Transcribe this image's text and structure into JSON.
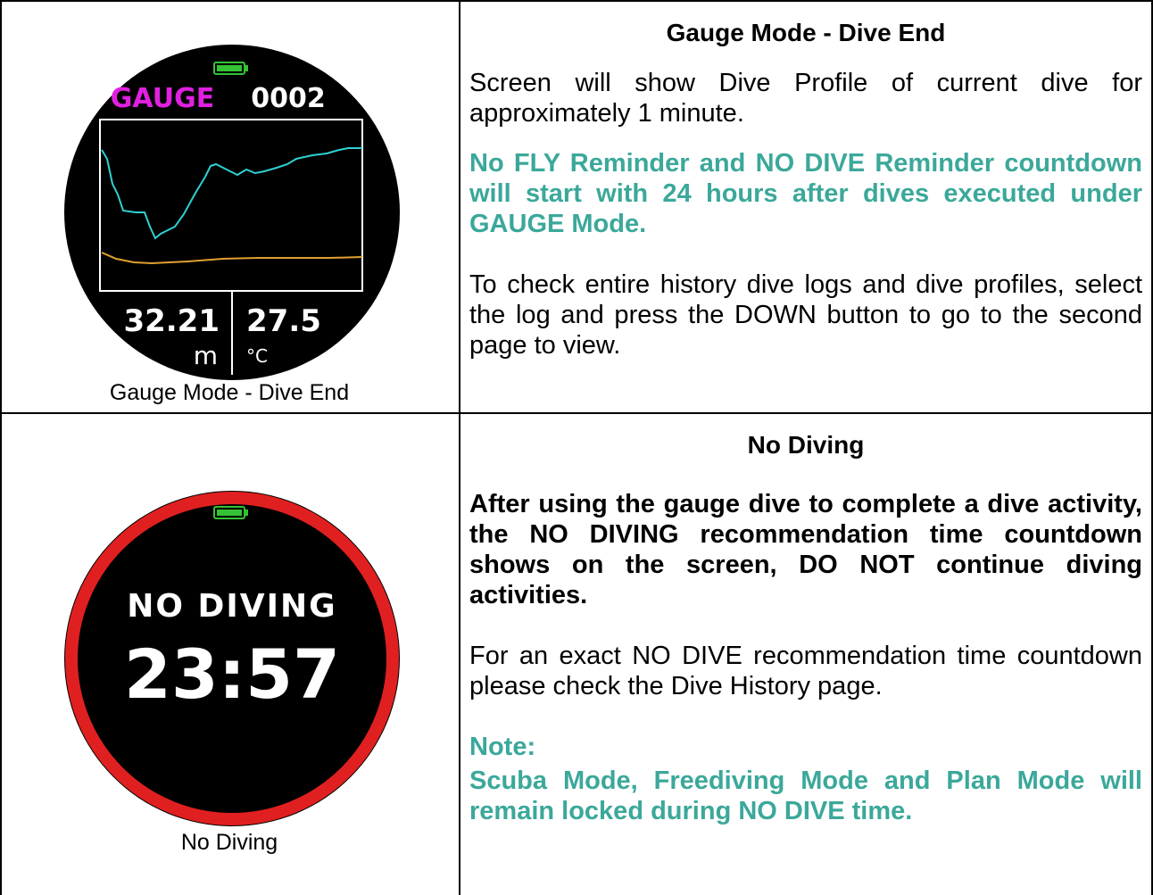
{
  "row1": {
    "watch": {
      "mode_label": "GAUGE",
      "dive_number": "0002",
      "depth_value": "32.21",
      "depth_unit": "m",
      "temp_value": "27.5",
      "temp_unit": "°C",
      "colors": {
        "mode": "#e020e0",
        "profile": "#30d0d0",
        "temp_line": "#e0a030",
        "battery": "#35c235"
      }
    },
    "caption": "Gauge Mode - Dive End",
    "heading": "Gauge Mode - Dive End",
    "para1": "Screen will show Dive Profile of current dive for approximately 1 minute.",
    "para2": "No FLY Reminder and NO DIVE Reminder countdown will start with 24 hours after dives executed under GAUGE Mode.",
    "para3": "To check entire history dive logs and dive profiles, select the log and press the DOWN button to go to the second page to view."
  },
  "row2": {
    "watch": {
      "title": "NO DIVING",
      "countdown": "23:57",
      "colors": {
        "ring": "#e02020",
        "battery": "#35c235"
      }
    },
    "caption": "No Diving",
    "heading": "No Diving",
    "para1": "After using the gauge dive to complete a dive activity, the NO DIVING recommendation time countdown shows on the screen, DO NOT continue diving activities.",
    "para2": "For an exact NO DIVE recommendation time countdown please check the Dive History page.",
    "note_label": "Note:",
    "note_text": "Scuba Mode, Freediving Mode and Plan Mode will remain locked during NO DIVE time."
  }
}
